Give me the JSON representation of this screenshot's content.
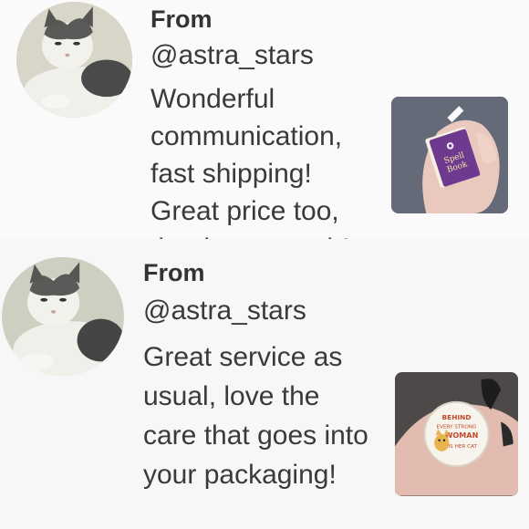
{
  "reviews": [
    {
      "from_label": "From",
      "handle": "@astra_stars",
      "text": "Wonderful communication, fast shipping! Great price too, thanks so much!",
      "photo": {
        "pin_text_line1": "Spell",
        "pin_text_line2": "Book"
      }
    },
    {
      "from_label": "From",
      "handle": "@astra_stars",
      "text": "Great service as usual, love the care that goes into your packaging!",
      "photo": {
        "pin_text_lines": [
          "BEHIND",
          "EVERY STRONG",
          "WOMAN",
          "IS HER CAT"
        ]
      }
    }
  ]
}
